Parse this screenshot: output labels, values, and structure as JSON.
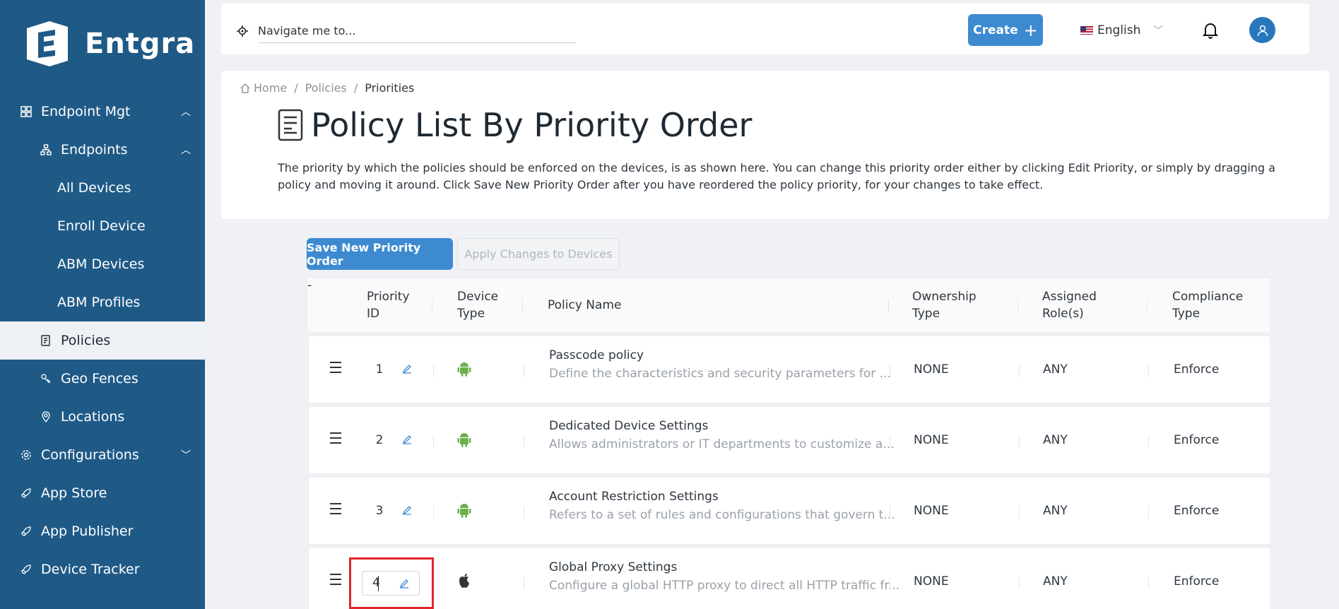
{
  "sidebar": {
    "brand": "Entgra",
    "items": [
      {
        "label": "Endpoint Mgt",
        "icon": "grid-icon",
        "chevron": "^"
      },
      {
        "label": "Endpoints",
        "icon": "hierarchy-icon",
        "chevron": "^"
      },
      {
        "label": "All Devices"
      },
      {
        "label": "Enroll Device"
      },
      {
        "label": "ABM Devices"
      },
      {
        "label": "ABM Profiles"
      },
      {
        "label": "Policies",
        "icon": "policy-doc-icon"
      },
      {
        "label": "Geo Fences",
        "icon": "geo-fence-icon"
      },
      {
        "label": "Locations",
        "icon": "location-pin-icon"
      },
      {
        "label": "Configurations",
        "icon": "gear-icon",
        "chevron": "v"
      },
      {
        "label": "App Store",
        "icon": "rocket-icon"
      },
      {
        "label": "App Publisher",
        "icon": "rocket-icon"
      },
      {
        "label": "Device Tracker",
        "icon": "rocket-icon"
      }
    ]
  },
  "topbar": {
    "search_placeholder": "Navigate me to...",
    "create_label": "Create",
    "create_icon": "+",
    "language": "English"
  },
  "breadcrumb": {
    "home": "Home",
    "policies": "Policies",
    "current": "Priorities",
    "separator": "/"
  },
  "page": {
    "title": "Policy List By Priority Order",
    "description": "The priority by which the policies should be enforced on the devices, is as shown here. You can change this priority order either by clicking Edit Priority, or simply by dragging a policy and moving it around. Click Save New Priority Order after you have reordered the policy priority, for your changes to take effect."
  },
  "actions": {
    "save_label": "Save New Priority Order",
    "apply_label": "Apply Changes to Devices"
  },
  "table": {
    "headers": {
      "priority_line1": "Priority",
      "priority_line2": "ID",
      "device_line1": "Device",
      "device_line2": "Type",
      "policy_name": "Policy Name",
      "ownership_line1": "Ownership",
      "ownership_line2": "Type",
      "roles_line1": "Assigned",
      "roles_line2": "Role(s)",
      "compliance_line1": "Compliance",
      "compliance_line2": "Type"
    },
    "rows": [
      {
        "priority": "1",
        "device": "android-icon",
        "name": "Passcode policy",
        "description": "Define the characteristics and security parameters for ...",
        "ownership": "NONE",
        "roles": "ANY",
        "compliance": "Enforce"
      },
      {
        "priority": "2",
        "device": "android-icon",
        "name": "Dedicated Device Settings",
        "description": "Allows administrators or IT departments to customize a...",
        "ownership": "NONE",
        "roles": "ANY",
        "compliance": "Enforce"
      },
      {
        "priority": "3",
        "device": "android-icon",
        "name": "Account Restriction Settings",
        "description": "Refers to a set of rules and configurations that govern t...",
        "ownership": "NONE",
        "roles": "ANY",
        "compliance": "Enforce"
      },
      {
        "priority": "4",
        "device": "apple-icon",
        "name": "Global Proxy Settings",
        "description": "Configure a global HTTP proxy to direct all HTTP traffic fr...",
        "ownership": "NONE",
        "roles": "ANY",
        "compliance": "Enforce"
      }
    ]
  },
  "colors": {
    "sidebar": "#1f5a87",
    "accent": "#3d8ad0",
    "android": "#6ab04c",
    "highlight": "#e0262d"
  }
}
